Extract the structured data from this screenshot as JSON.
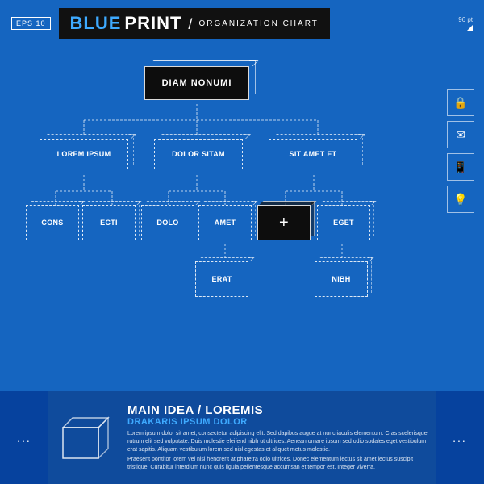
{
  "header": {
    "eps_label": "EPS 10",
    "title_blue": "BLUE",
    "title_white": "PRINT",
    "slash": "/",
    "subtitle": "ORGANIZATION CHART",
    "pt_label": "96 pt"
  },
  "sidebar_icons": [
    "lock",
    "mail",
    "phone",
    "bulb"
  ],
  "chart": {
    "top_node": "DIAM NONUMI",
    "mid_nodes": [
      "LOREM IPSUM",
      "DOLOR SITAM",
      "SIT AMET ET"
    ],
    "bot_nodes": [
      "CONS",
      "ECTI",
      "DOLO",
      "AMET",
      "+",
      "EGET"
    ],
    "last_nodes": [
      "ERAT",
      "NIBH"
    ]
  },
  "bottom": {
    "left_dots": "...",
    "right_dots": "...",
    "main_idea": "MAIN IDEA / LOREMIS",
    "drakaris": "DRAKARIS IPSUM DOLOR",
    "body1": "Lorem ipsum dolor sit amet, consectetur adipiscing elit. Sed dapibus augue at nunc iaculis elementum. Cras scelerisque rutrum elit sed vulputate. Duis molestie eleifend nibh ut ultrices. Aenean ornare ipsum sed odio sodales eget vestibulum erat sapitis. Aliquam vestibulum lorem sed nisl egestas et aliquet metus molestie.",
    "body2": "Praesent porttitor lorem vel nisi hendrerit at pharetra odio ultrices. Donec elementum lectus sit amet lectus suscipit tristique. Curabitur interdium nunc quis ligula pellentesque accumsan et tempor est. Integer viverra."
  }
}
